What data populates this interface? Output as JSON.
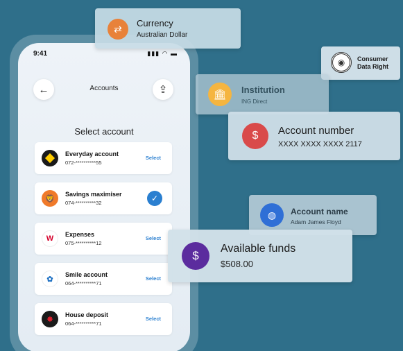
{
  "phone": {
    "status_time": "9:41",
    "status_icons": "▮▮▮ ◠ ▬",
    "nav": {
      "back_icon": "back-arrow-icon",
      "title": "Accounts",
      "share_icon": "share-icon"
    },
    "heading": "Select account",
    "accounts": [
      {
        "name": "Everyday account",
        "number": "072-**********55",
        "action": "Select",
        "selected": false,
        "logo_color": "#1a1a1a"
      },
      {
        "name": "Savings maximiser",
        "number": "074-**********32",
        "action": "",
        "selected": true,
        "logo_color": "#f07a2a"
      },
      {
        "name": "Expenses",
        "number": "075-**********12",
        "action": "Select",
        "selected": false,
        "logo_color": "#ffffff"
      },
      {
        "name": "Smile account",
        "number": "064-**********71",
        "action": "Select",
        "selected": false,
        "logo_color": "#ffffff"
      },
      {
        "name": "House deposit",
        "number": "064-**********71",
        "action": "Select",
        "selected": false,
        "logo_color": "#1a1a1a"
      }
    ]
  },
  "cards": {
    "currency": {
      "title": "Currency",
      "value": "Australian Dollar",
      "icon": "currency-exchange-icon",
      "color": "#e8823a"
    },
    "cdr": {
      "line1": "Consumer",
      "line2": "Data Right",
      "icon": "consumer-data-right-logo"
    },
    "institution": {
      "title": "Institution",
      "value": "ING Direct",
      "icon": "bank-icon",
      "color": "#f5b540"
    },
    "account_number": {
      "title": "Account number",
      "value": "XXXX XXXX XXXX 2117",
      "icon": "money-hand-icon",
      "color": "#d94a4a"
    },
    "account_name": {
      "title": "Account name",
      "value": "Adam James Floyd",
      "icon": "person-badge-icon",
      "color": "#2f6fd6"
    },
    "available_funds": {
      "title": "Available funds",
      "value": "$508.00",
      "icon": "atm-cash-icon",
      "color": "#5b2c9e"
    }
  }
}
